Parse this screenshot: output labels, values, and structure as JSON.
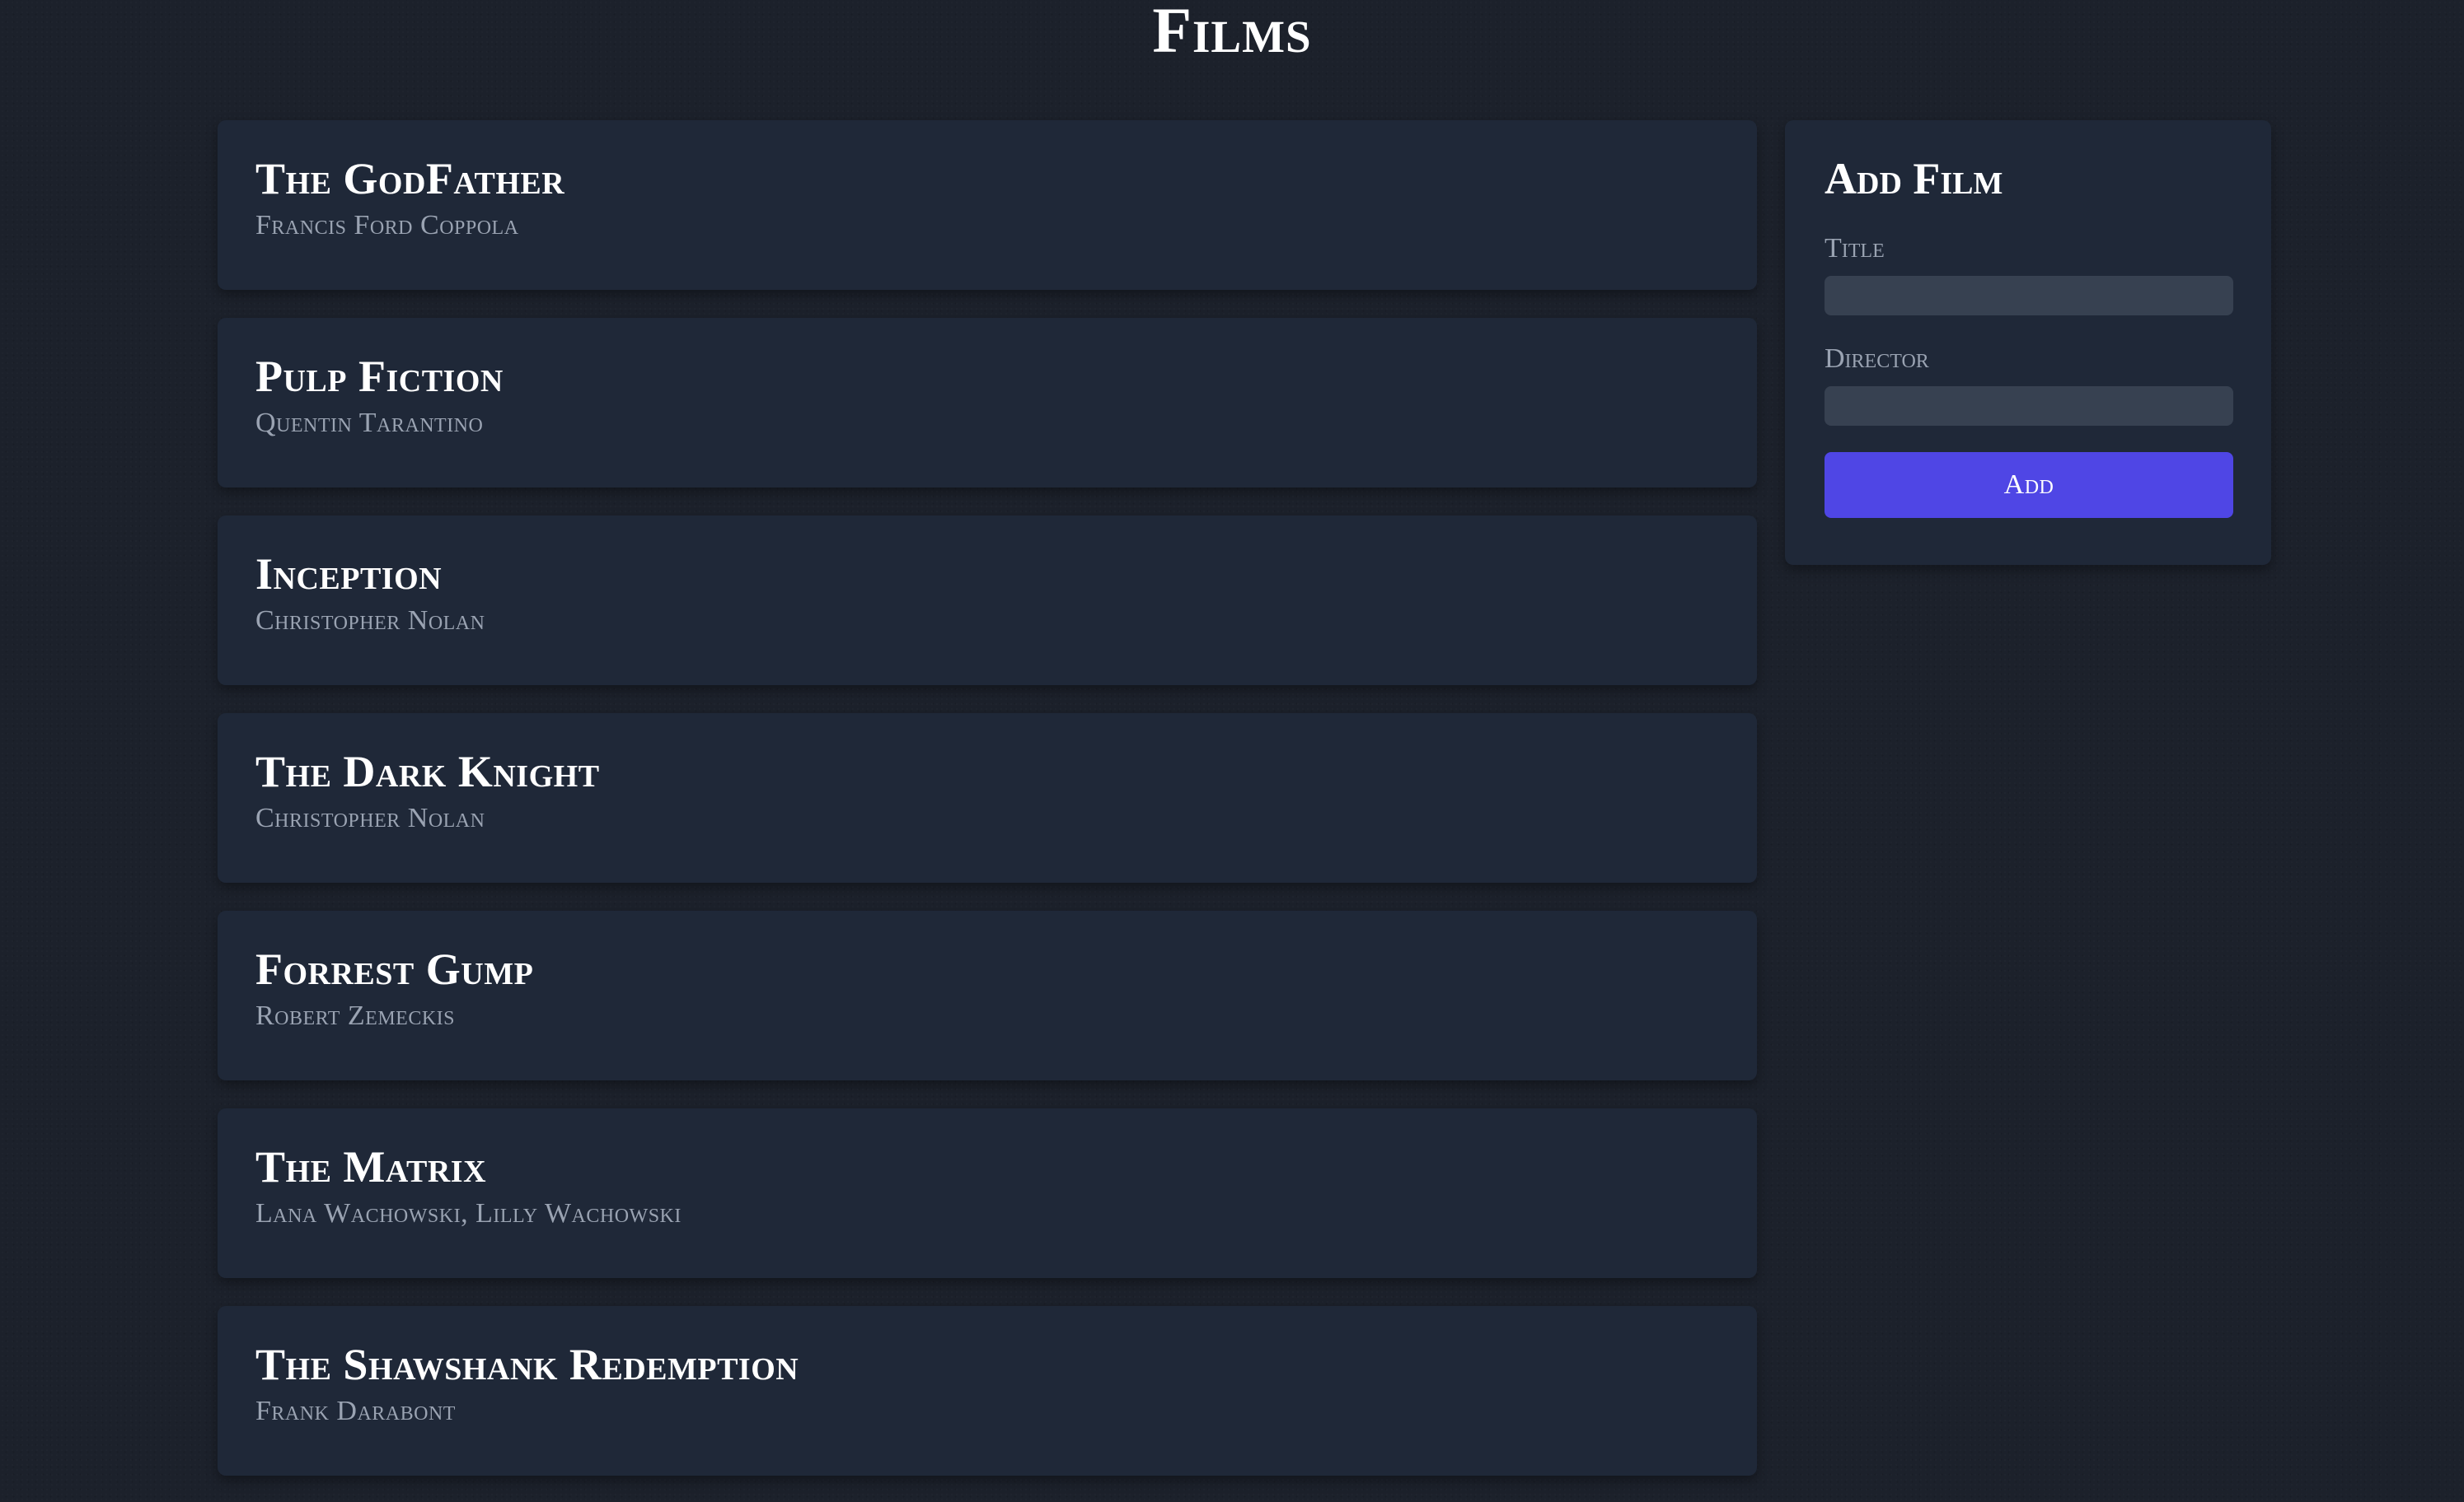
{
  "page": {
    "title": "Films"
  },
  "films": [
    {
      "title": "The GodFather",
      "director": "Francis Ford Coppola"
    },
    {
      "title": "Pulp Fiction",
      "director": "Quentin Tarantino"
    },
    {
      "title": "Inception",
      "director": "Christopher Nolan"
    },
    {
      "title": "The Dark Knight",
      "director": "Christopher Nolan"
    },
    {
      "title": "Forrest Gump",
      "director": "Robert Zemeckis"
    },
    {
      "title": "The Matrix",
      "director": "Lana Wachowski, Lilly Wachowski"
    },
    {
      "title": "The Shawshank Redemption",
      "director": "Frank Darabont"
    }
  ],
  "add_form": {
    "heading": "Add Film",
    "title_label": "Title",
    "title_value": "",
    "director_label": "Director",
    "director_value": "",
    "submit_label": "Add"
  },
  "colors": {
    "background": "#1c212b",
    "card": "#1f2838",
    "input": "#374151",
    "accent": "#4f46e5",
    "muted_text": "#9aa3b2"
  }
}
